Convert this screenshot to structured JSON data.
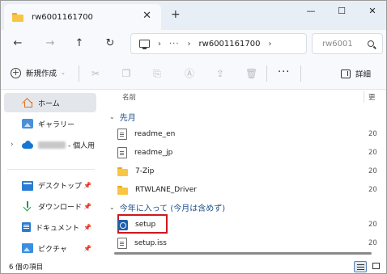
{
  "window": {
    "tab_title": "rw6001161700",
    "new_tab_label": "+",
    "close_tab_label": "✕",
    "minimize_label": "—",
    "maximize_label": "☐",
    "close_label": "✕"
  },
  "address": {
    "path_separator": "›",
    "ellipsis": "···",
    "current_folder": "rw6001161700",
    "trailing_separator": "›",
    "search_placeholder": "rw6001"
  },
  "toolbar": {
    "new_label": "新規作成",
    "more_label": "···",
    "details_label": "詳細"
  },
  "sidebar": {
    "items": [
      {
        "label": "ホーム",
        "icon": "home-icon",
        "selected": true
      },
      {
        "label": "ギャラリー",
        "icon": "gallery-icon"
      },
      {
        "label": "- 個人用",
        "icon": "onedrive-icon"
      },
      {
        "label": "デスクトップ",
        "icon": "desktop-icon"
      },
      {
        "label": "ダウンロード",
        "icon": "download-icon"
      },
      {
        "label": "ドキュメント",
        "icon": "documents-icon"
      },
      {
        "label": "ピクチャ",
        "icon": "pictures-icon"
      }
    ]
  },
  "columns": {
    "name": "名前",
    "date": "更"
  },
  "groups": [
    {
      "label": "先月"
    },
    {
      "label": "今年に入って (今月は含めず)"
    }
  ],
  "files": [
    {
      "name": "readme_en",
      "date": "20",
      "type": "file"
    },
    {
      "name": "readme_jp",
      "date": "20",
      "type": "file"
    },
    {
      "name": "7-Zip",
      "date": "20",
      "type": "folder"
    },
    {
      "name": "RTWLANE_Driver",
      "date": "20",
      "type": "folder"
    },
    {
      "name": "setup",
      "date": "20",
      "type": "setup",
      "highlighted": true
    },
    {
      "name": "setup.iss",
      "date": "20",
      "type": "file"
    }
  ],
  "status": {
    "item_count": "6 個の項目"
  },
  "colors": {
    "highlight_border": "#d0161e",
    "group_header": "#1e4f8a",
    "folder": "#f8c644"
  }
}
